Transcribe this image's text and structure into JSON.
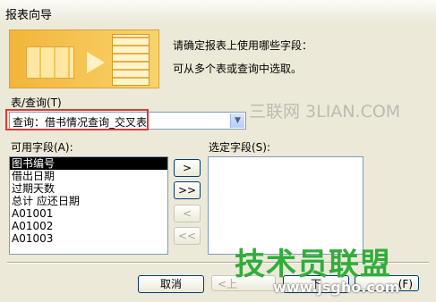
{
  "window": {
    "title": "报表向导"
  },
  "intro": {
    "line1": "请确定报表上使用哪些字段：",
    "line2": "可从多个表或查询中选取。"
  },
  "source": {
    "label": "表/查询(T)",
    "selected": "查询：借书情况查询_交叉表"
  },
  "available": {
    "label": "可用字段(A):",
    "items": [
      "图书编号",
      "借出日期",
      "过期天数",
      "总计 应还日期",
      "A01001",
      "A01002",
      "A01003"
    ]
  },
  "selected_fields": {
    "label": "选定字段(S):",
    "items": []
  },
  "move_buttons": {
    "add": ">",
    "add_all": ">>",
    "remove": "<",
    "remove_all": "<<"
  },
  "footer": {
    "cancel": "取消",
    "back": "<上",
    "next": "下",
    "finish": "(F)"
  },
  "watermarks": {
    "top": "三联网 3LIAN.COM",
    "bottom_big": "技术员联盟",
    "bottom_url": "www.jsgho.com"
  },
  "colors": {
    "highlight": "#d93a3a",
    "watermark_green": "#2fae3a"
  },
  "icons": [
    "report-wizard-banner-icon",
    "dropdown-arrow-icon"
  ]
}
